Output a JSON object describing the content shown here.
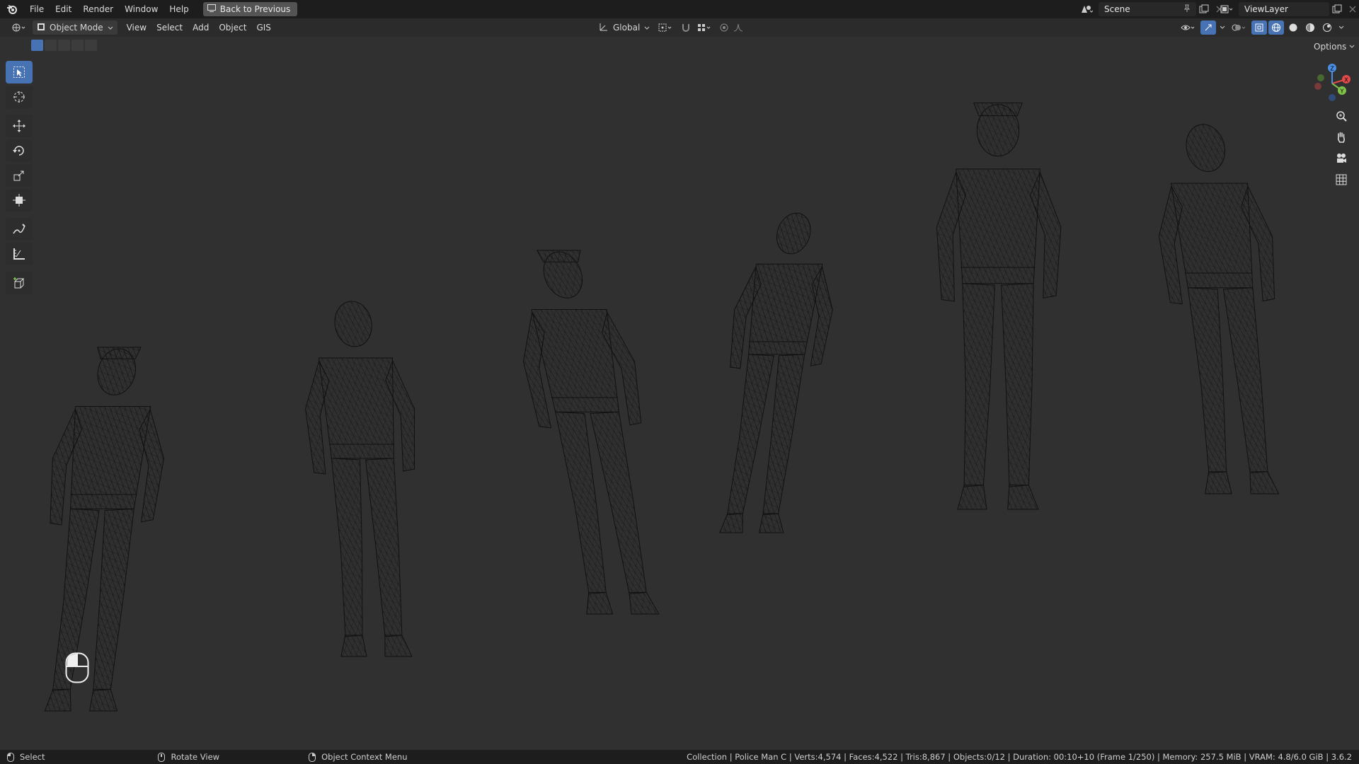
{
  "menu": {
    "file": "File",
    "edit": "Edit",
    "render": "Render",
    "window": "Window",
    "help": "Help",
    "back_to_previous": "Back to Previous"
  },
  "scene": {
    "label": "Scene"
  },
  "view_layer": {
    "label": "ViewLayer"
  },
  "header": {
    "mode": "Object Mode",
    "view": "View",
    "select": "Select",
    "add": "Add",
    "object": "Object",
    "gis": "GIS",
    "orientation": "Global",
    "options": "Options"
  },
  "gizmo": {
    "x": "X",
    "y": "Y",
    "z": "Z"
  },
  "status": {
    "select": "Select",
    "rotate_view": "Rotate View",
    "context_menu": "Object Context Menu",
    "stats": "Collection | Police Man C | Verts:4,574 | Faces:4,522 | Tris:8,867 | Objects:0/12 | Duration: 00:10+10 (Frame 1/250) | Memory: 257.5 MiB | VRAM: 4.8/6.0 GiB | 3.6.2"
  },
  "colors": {
    "accent": "#4772b3",
    "axis_x": "#e34a4a",
    "axis_y": "#7fc249",
    "axis_z": "#4a8fe3",
    "wire": "#111111"
  },
  "icons": [
    "blender-logo-icon",
    "select-box-icon",
    "cursor-icon",
    "move-icon",
    "rotate-icon",
    "scale-icon",
    "transform-icon",
    "annotate-icon",
    "measure-icon",
    "add-cube-icon",
    "zoom-icon",
    "pan-hand-icon",
    "camera-icon",
    "grid-icon",
    "mouse-icon"
  ]
}
